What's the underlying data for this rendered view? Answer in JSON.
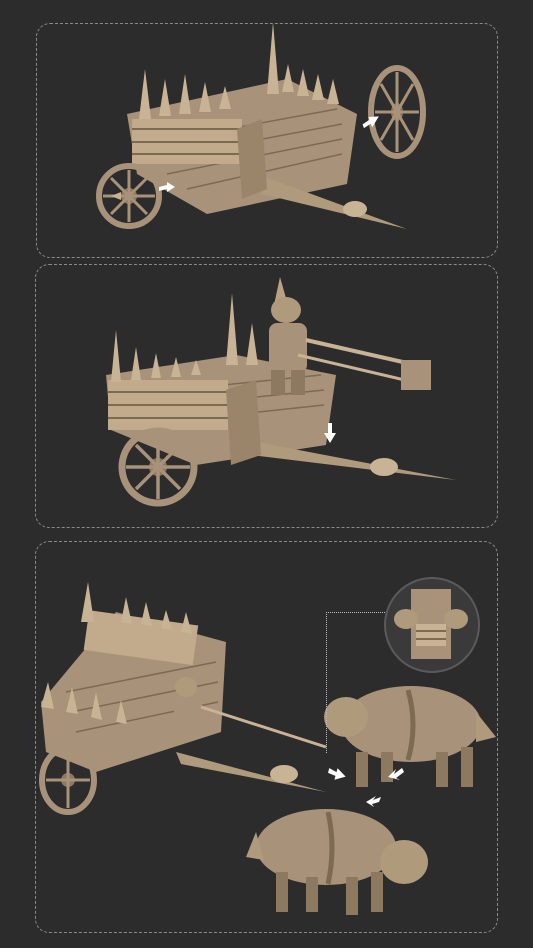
{
  "colors": {
    "background": "#2c2c2c",
    "panel_border": "#8a8a8a",
    "model": "#b09a7c",
    "model_shadow": "#7d6a52",
    "model_highlight": "#d4c0a2",
    "arrow": "#ffffff"
  },
  "steps": [
    {
      "step": 1,
      "content": "chariot-frame-with-detached-wheels",
      "arrows": [
        "wheel-attach-right",
        "wheel-attach-left"
      ]
    },
    {
      "step": 2,
      "content": "chariot-with-goblin-driver",
      "arrows": [
        "driver-mount-down"
      ]
    },
    {
      "step": 3,
      "content": "chariot-with-wolves",
      "arrows": [
        "wolf-hitch-top",
        "wolf-hitch-left",
        "wolf-hitch-bottom"
      ],
      "detail_inset": "harness-closeup"
    }
  ]
}
